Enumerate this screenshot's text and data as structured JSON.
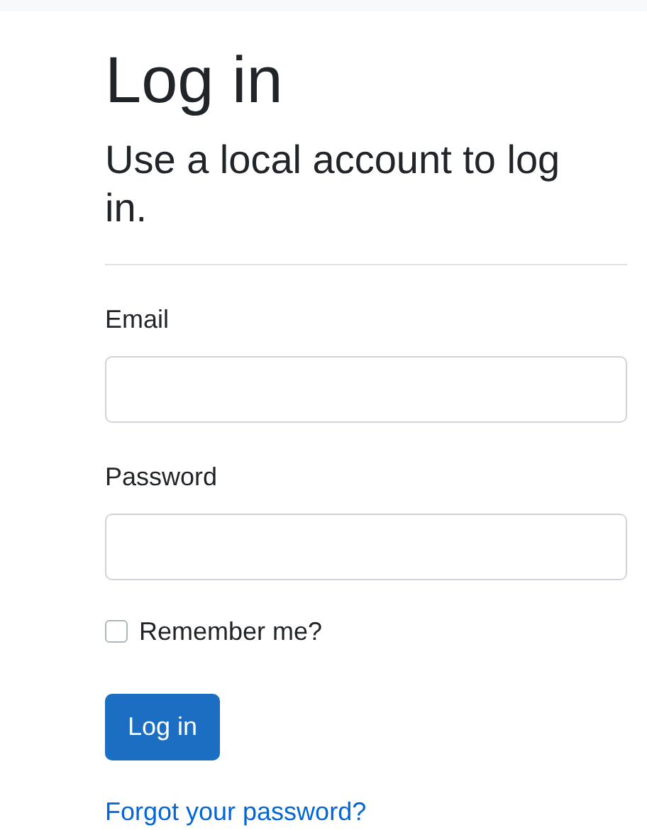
{
  "title": "Log in",
  "subtitle": "Use a local account to log in.",
  "fields": [
    {
      "label": "Email"
    },
    {
      "label": "Password"
    }
  ],
  "remember": {
    "label": "Remember me?",
    "checked": false
  },
  "button": "Log in",
  "link": "Forgot your password?"
}
